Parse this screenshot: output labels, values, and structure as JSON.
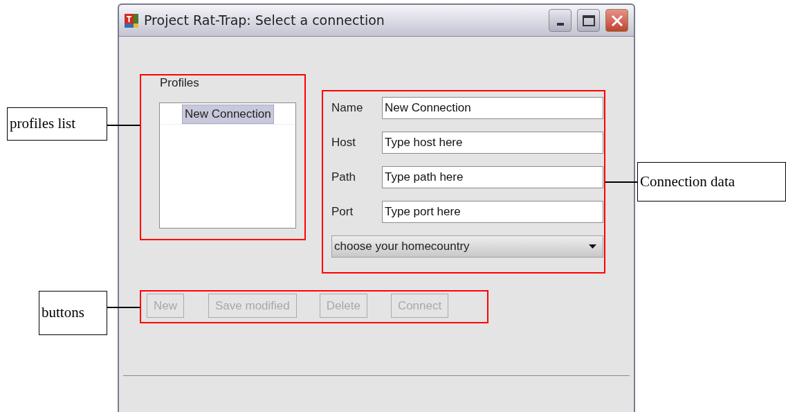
{
  "window": {
    "title": "Project Rat-Trap: Select a connection"
  },
  "profiles": {
    "label": "Profiles",
    "items": [
      {
        "label": "New Connection",
        "selected": true
      }
    ]
  },
  "fields": [
    {
      "label": "Name",
      "value": "New Connection"
    },
    {
      "label": "Host",
      "value": "Type host here"
    },
    {
      "label": "Path",
      "value": "Type path here"
    },
    {
      "label": "Port",
      "value": "Type port here"
    }
  ],
  "country_dropdown": {
    "value": "choose your homecountry"
  },
  "buttons": [
    {
      "label": "New",
      "disabled": true
    },
    {
      "label": "Save modified",
      "disabled": true
    },
    {
      "label": "Delete",
      "disabled": true
    },
    {
      "label": "Connect",
      "disabled": true
    }
  ],
  "annotations": [
    {
      "text": "profiles list"
    },
    {
      "text": "Connection data"
    },
    {
      "text": "buttons"
    }
  ]
}
